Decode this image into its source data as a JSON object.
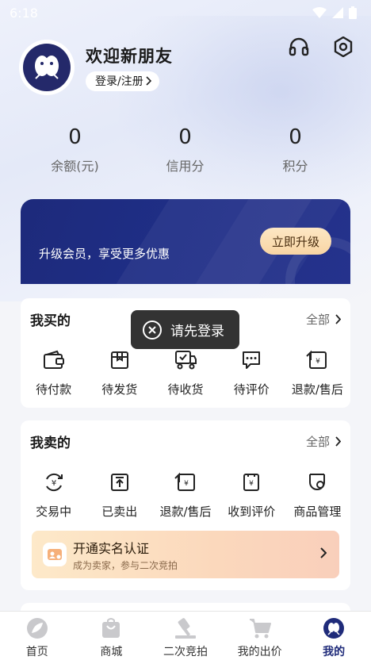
{
  "status_bar": {
    "time": "6:18"
  },
  "header": {
    "welcome": "欢迎新朋友",
    "login_label": "登录/注册",
    "actions": [
      "headset-icon",
      "settings-icon"
    ]
  },
  "stats": [
    {
      "value": "0",
      "label": "余额(元)"
    },
    {
      "value": "0",
      "label": "信用分"
    },
    {
      "value": "0",
      "label": "积分"
    }
  ],
  "vip_banner": {
    "text": "升级会员，享受更多优惠",
    "button": "立即升级"
  },
  "buy_section": {
    "title": "我买的",
    "all_label": "全部",
    "items": [
      {
        "label": "待付款",
        "icon": "wallet-icon"
      },
      {
        "label": "待发货",
        "icon": "package-icon"
      },
      {
        "label": "待收货",
        "icon": "delivery-truck-icon"
      },
      {
        "label": "待评价",
        "icon": "comment-icon"
      },
      {
        "label": "退款/售后",
        "icon": "refund-icon"
      }
    ]
  },
  "sell_section": {
    "title": "我卖的",
    "all_label": "全部",
    "items": [
      {
        "label": "交易中",
        "icon": "yuan-cycle-icon"
      },
      {
        "label": "已卖出",
        "icon": "upload-box-icon"
      },
      {
        "label": "退款/售后",
        "icon": "refund-icon"
      },
      {
        "label": "收到评价",
        "icon": "yuan-doc-icon"
      },
      {
        "label": "商品管理",
        "icon": "product-manage-icon"
      }
    ]
  },
  "verify_banner": {
    "title": "开通实名认证",
    "subtitle": "成为卖家，参与二次竞拍"
  },
  "toast": {
    "text": "请先登录"
  },
  "tab_bar": {
    "active_index": 4,
    "tabs": [
      {
        "label": "首页",
        "icon": "home-leaf-icon"
      },
      {
        "label": "商城",
        "icon": "shopping-bag-icon"
      },
      {
        "label": "二次竞拍",
        "icon": "auction-hammer-icon"
      },
      {
        "label": "我的出价",
        "icon": "cart-icon"
      },
      {
        "label": "我的",
        "icon": "profile-icon"
      }
    ]
  },
  "colors": {
    "brand_navy": "#1f2b7a",
    "gold_button": "#f8d5a4",
    "toast_bg": "#222222"
  }
}
